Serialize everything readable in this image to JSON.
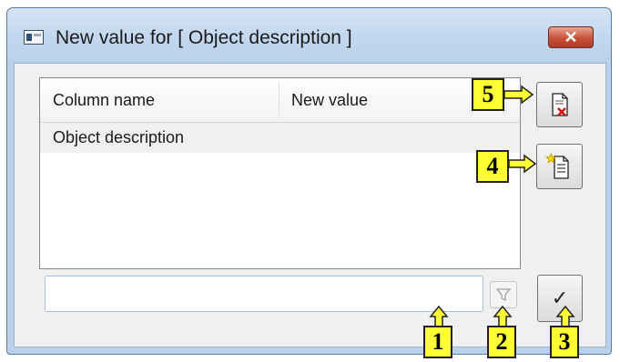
{
  "window": {
    "title": "New value for [ Object description ]",
    "close_label": "✕"
  },
  "grid": {
    "columns": [
      "Column name",
      "New value"
    ],
    "rows": [
      {
        "column_name": "Object description",
        "new_value": ""
      }
    ]
  },
  "filter": {
    "value": "",
    "placeholder": ""
  },
  "buttons": {
    "ok_label": "✓"
  },
  "callouts": [
    "1",
    "2",
    "3",
    "4",
    "5"
  ],
  "colors": {
    "callout_fill": "#ffff33",
    "title_gradient_top": "#d6e5f5",
    "close_button": "#c9503a"
  }
}
